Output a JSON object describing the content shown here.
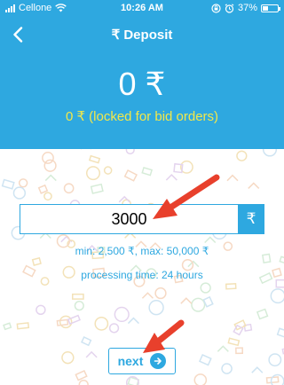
{
  "status_bar": {
    "carrier": "Cellone",
    "time": "10:26 AM",
    "battery_percent": "37%",
    "battery_level": 0.37,
    "icons": [
      "signal-icon",
      "wifi-icon",
      "orientation-lock-icon",
      "alarm-icon",
      "battery-icon"
    ]
  },
  "nav": {
    "back_icon": "chevron-left-icon",
    "title": "₹ Deposit"
  },
  "balance": {
    "amount": "0 ₹",
    "locked": "0 ₹ (locked for bid orders)"
  },
  "deposit_form": {
    "amount_value": "3000",
    "currency_symbol": "₹",
    "limits": "min: 2,500 ₹, max: 50,000 ₹",
    "processing": "processing time: 24 hours"
  },
  "next_button": {
    "label": "next",
    "icon": "arrow-right-circle-icon"
  },
  "annotations": {
    "arrow_color": "#e8402c",
    "count": 2
  },
  "colors": {
    "primary": "#2ea8e0",
    "locked_text": "#f2e84a",
    "annotation": "#e8402c"
  }
}
